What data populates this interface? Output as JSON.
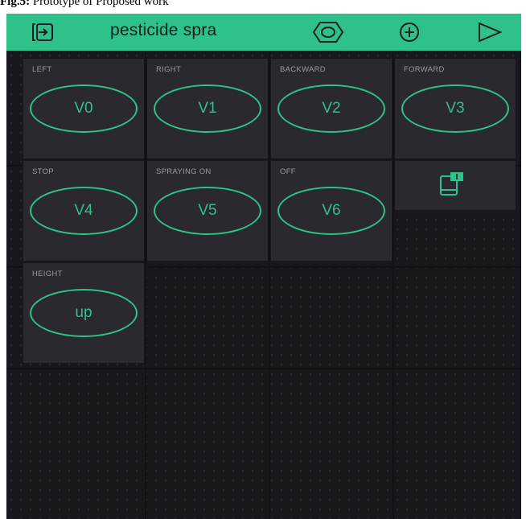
{
  "caption": {
    "prefix": "Fig.5:",
    "text": " Prototype of Proposed work"
  },
  "app": {
    "title": "pesticide spra",
    "icons": [
      "device-icon",
      "settings-icon",
      "add-icon",
      "play-icon"
    ],
    "accent_color": "#2ec18a"
  },
  "widgets": [
    {
      "label": "LEFT",
      "button": "V0"
    },
    {
      "label": "RIGHT",
      "button": "V1"
    },
    {
      "label": "BACKWARD",
      "button": "V2"
    },
    {
      "label": "FORWARD",
      "button": "V3"
    },
    {
      "label": "STOP",
      "button": "V4"
    },
    {
      "label": "SPRAYING ON",
      "button": "V5"
    },
    {
      "label": "OFF",
      "button": "V6"
    },
    {
      "label": "HEIGHT",
      "button": "up"
    }
  ],
  "device_widget": {
    "icon": "device-notification-icon"
  }
}
